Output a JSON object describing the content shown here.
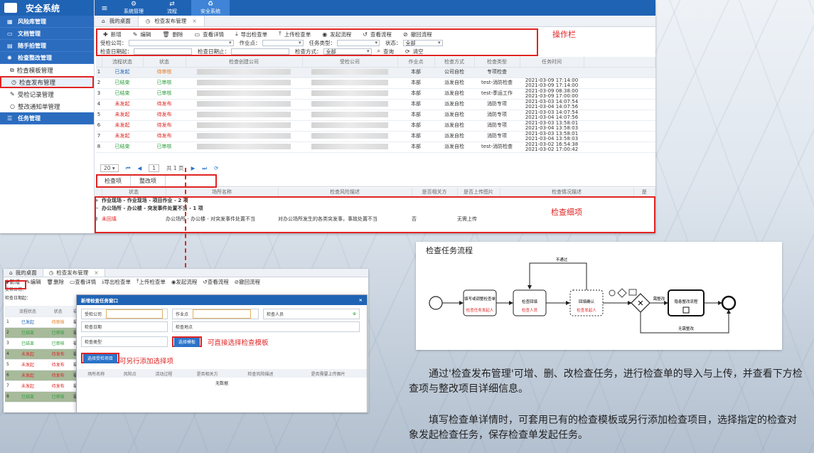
{
  "app": {
    "title": "安全系统"
  },
  "topnav": [
    {
      "label": "系统管理",
      "icon": "gears-icon"
    },
    {
      "label": "流程",
      "icon": "exchange-icon"
    },
    {
      "label": "安全系统",
      "icon": "recycle-icon"
    }
  ],
  "sidebar": {
    "items": [
      {
        "label": "风险库管理",
        "type": "group"
      },
      {
        "label": "文档管理",
        "type": "group"
      },
      {
        "label": "随手拍管理",
        "type": "group"
      },
      {
        "label": "检查整改管理",
        "type": "group"
      },
      {
        "label": "检查模板管理",
        "type": "sub"
      },
      {
        "label": "检查发布管理",
        "type": "sub",
        "active": true
      },
      {
        "label": "受检记录管理",
        "type": "sub"
      },
      {
        "label": "整改通知单管理",
        "type": "sub"
      },
      {
        "label": "任务管理",
        "type": "group"
      }
    ]
  },
  "tabs": [
    {
      "label": "我的桌面"
    },
    {
      "label": "检查发布管理"
    }
  ],
  "toolbar": {
    "buttons": [
      "新增",
      "编辑",
      "删除",
      "查看详情",
      "导出检查单",
      "上传检查单",
      "发起流程",
      "查看流程",
      "撤回流程"
    ]
  },
  "filters": {
    "check_company": "受检公司：",
    "work_point": "作业点：",
    "task_type": "任务类型：",
    "status": "状态：",
    "status_value": "全部",
    "date_start": "检查日期起：",
    "date_end": "检查日期止：",
    "check_method": "检查方式：",
    "method_value": "全部",
    "search": "查询",
    "clear": "清空"
  },
  "annotations": {
    "ops": "操作栏",
    "detail": "检查细项",
    "choose_template": "可直接选择检查模板",
    "add_item": "可另行添加选择项"
  },
  "grid": {
    "headers": [
      "流程状态",
      "状态",
      "检查创建公司",
      "受检公司",
      "作业点",
      "检查方式",
      "检查类型",
      "任务时间"
    ],
    "rows": [
      {
        "no": "1",
        "flow": "已发起",
        "status": "待审核",
        "point": "本部",
        "method": "公司自检",
        "type": "专项检查",
        "time1": "",
        "time2": ""
      },
      {
        "no": "2",
        "flow": "已结束",
        "status": "已审核",
        "point": "本部",
        "method": "派发自检",
        "type": "test-消防检查",
        "time1": "2021-03-09 17:14:00",
        "time2": "2021-03-09 17:14:00"
      },
      {
        "no": "3",
        "flow": "已结束",
        "status": "已审核",
        "point": "本部",
        "method": "派发自检",
        "type": "test-季运工作",
        "time1": "2021-03-09 08:38:00",
        "time2": "2021-03-09 17:00:00"
      },
      {
        "no": "4",
        "flow": "未发起",
        "status": "待发布",
        "point": "本部",
        "method": "派发自检",
        "type": "消防专项",
        "time1": "2021-03-03 14:07:54",
        "time2": "2021-03-04 14:07:56"
      },
      {
        "no": "5",
        "flow": "未发起",
        "status": "待发布",
        "point": "本部",
        "method": "派发自检",
        "type": "消防专项",
        "time1": "2021-03-03 14:07:54",
        "time2": "2021-03-04 14:07:56"
      },
      {
        "no": "6",
        "flow": "未发起",
        "status": "待发布",
        "point": "本部",
        "method": "派发自检",
        "type": "消防专项",
        "time1": "2021-03-03 13:58:01",
        "time2": "2021-03-04 13:58:03"
      },
      {
        "no": "7",
        "flow": "未发起",
        "status": "待发布",
        "point": "本部",
        "method": "派发自检",
        "type": "消防专项",
        "time1": "2021-03-03 13:58:01",
        "time2": "2021-03-04 13:58:03"
      },
      {
        "no": "8",
        "flow": "已结束",
        "status": "已审核",
        "point": "本部",
        "method": "派发自检",
        "type": "test-消防检查",
        "time1": "2021-03-02 16:54:38",
        "time2": "2021-03-02 17:00:42"
      }
    ]
  },
  "pager": {
    "size": "20",
    "page": "1",
    "total": "共 1 页"
  },
  "subtabs": [
    "检查项",
    "整改项"
  ],
  "detail": {
    "headers": [
      "状态",
      "场所名称",
      "检查风险描述",
      "是否相关方",
      "是否上传图片",
      "检查情况描述",
      "是"
    ],
    "groups": [
      "作业现场 - 作业现场 - 项目作业 - 2 项",
      "办公场所 - 办公楼 - 突发事件处置不当 - 1 项"
    ],
    "row": {
      "no": "3",
      "status": "未回填",
      "place": "办公场所 - 办公楼 - 对突发事件处置不当",
      "risk": "对办公场所发生的各类突发事，事故处置不当",
      "related": "否",
      "upload": "无需上传"
    }
  },
  "shot2": {
    "tabs": [
      "我的桌面",
      "检查发布管理"
    ],
    "toolbar": [
      "新增",
      "编辑",
      "删除",
      "查看详情",
      "导出检查单",
      "上传检查单",
      "发起流程",
      "查看流程",
      "撤回流程"
    ],
    "filter1": "受检公司：",
    "filter2": "检查日期起：",
    "grid_headers": [
      "流程状态",
      "状态",
      "福"
    ],
    "rows": [
      [
        "1",
        "已发起",
        "待审核",
        "福"
      ],
      [
        "2",
        "已结束",
        "已审核",
        "福"
      ],
      [
        "3",
        "已结束",
        "已审核",
        "福"
      ],
      [
        "4",
        "未发起",
        "待发布",
        "福"
      ],
      [
        "5",
        "未发起",
        "待发布",
        "福"
      ],
      [
        "6",
        "未发起",
        "待发布",
        "福"
      ],
      [
        "7",
        "未发起",
        "待发布",
        "福"
      ],
      [
        "8",
        "已结束",
        "已审核",
        "福"
      ]
    ],
    "modal": {
      "title": "新增检查任务窗口",
      "check_company": "受检公司",
      "work_point": "作业点",
      "inspector": "检查人员",
      "check_date": "检查日期",
      "check_place": "检查地点",
      "check_type": "检查类型",
      "template_btn": "选择模板",
      "add_btn": "选择受检项目",
      "headers": [
        "场所名称",
        "风险点",
        "活动过程",
        "是否相关方",
        "检查风险描述",
        "是否需要上传图片"
      ],
      "empty": "无数据"
    }
  },
  "flow": {
    "title": "检查任务流程",
    "nodes": [
      {
        "text": "填写或调整检查单",
        "role": "检查任务发起人"
      },
      {
        "text": "检查回填",
        "role": "检查人员"
      },
      {
        "text": "回填确认",
        "role": "检查发起人"
      },
      {
        "text": "隐患整改流程",
        "role": ""
      }
    ],
    "edges": {
      "reject": "不通过",
      "rectify": "需整改",
      "no_rectify": "无需整改"
    }
  },
  "description": {
    "p1": "通过'检查发布管理'可增、删、改检查任务，进行检查单的导入与上传，并查看下方检查项与整改项目详细信息。",
    "p2": "填写检查单详情时，可套用已有的检查模板或另行添加检查项目，选择指定的检查对象发起检查任务，保存检查单发起任务。"
  }
}
